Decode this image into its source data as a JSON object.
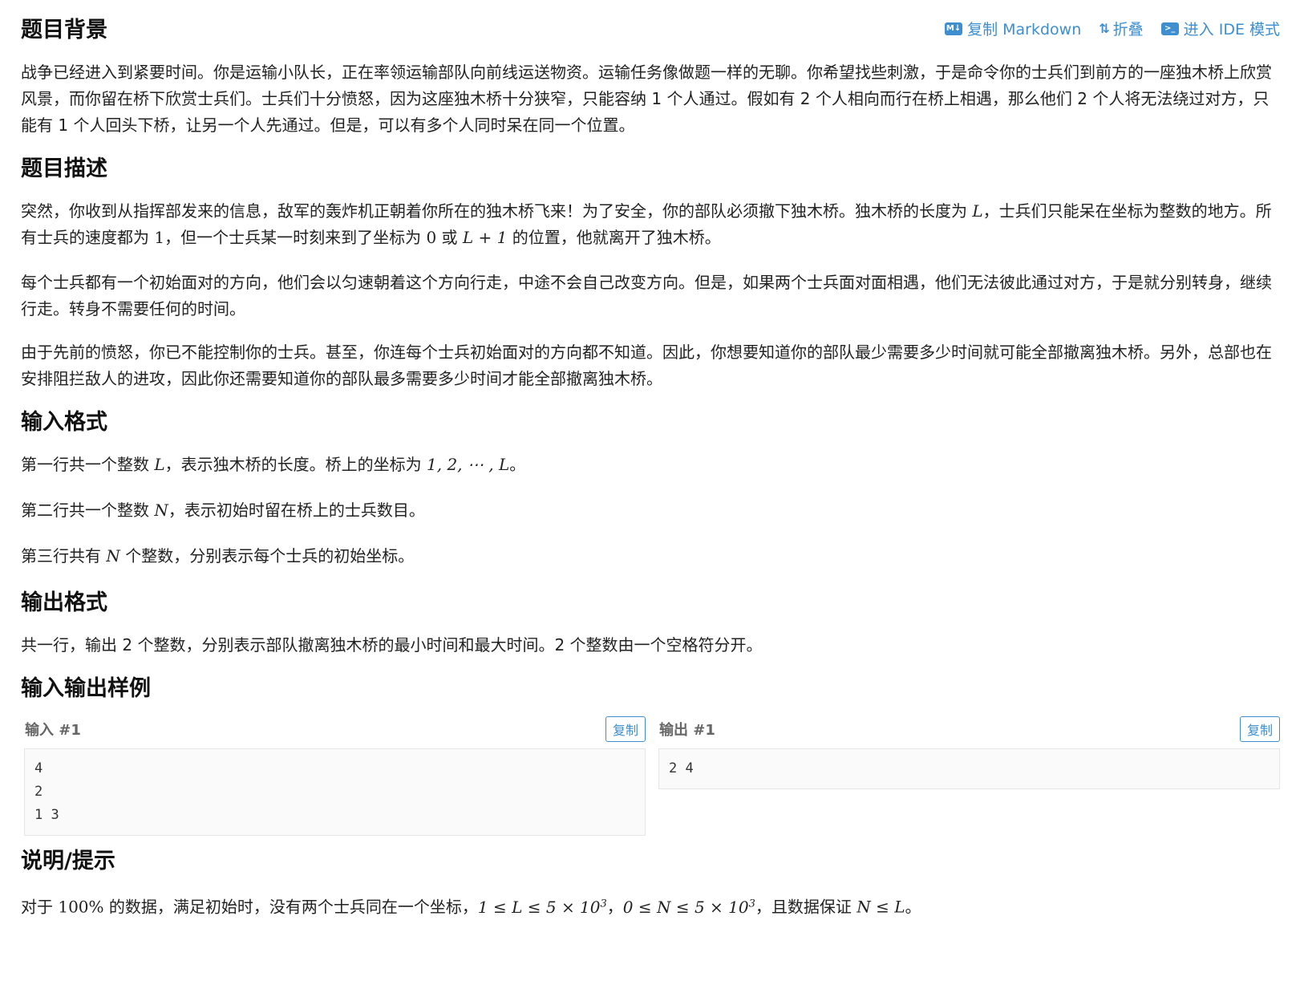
{
  "toolbar": {
    "copy_md_icon": "M↓",
    "copy_md_label": "复制 Markdown",
    "fold_label": "折叠",
    "ide_label": "进入 IDE 模式"
  },
  "sections": {
    "background": {
      "title": "题目背景",
      "p1": "战争已经进入到紧要时间。你是运输小队长，正在率领运输部队向前线运送物资。运输任务像做题一样的无聊。你希望找些刺激，于是命令你的士兵们到前方的一座独木桥上欣赏风景，而你留在桥下欣赏士兵们。士兵们十分愤怒，因为这座独木桥十分狭窄，只能容纳 1 个人通过。假如有 2 个人相向而行在桥上相遇，那么他们 2 个人将无法绕过对方，只能有 1 个人回头下桥，让另一个人先通过。但是，可以有多个人同时呆在同一个位置。"
    },
    "description": {
      "title": "题目描述",
      "p1a": "突然，你收到从指挥部发来的信息，敌军的轰炸机正朝着你所在的独木桥飞来！为了安全，你的部队必须撤下独木桥。独木桥的长度为 ",
      "p1b": "，士兵们只能呆在坐标为整数的地方。所有士兵的速度都为 ",
      "p1c": "，但一个士兵某一时刻来到了坐标为 ",
      "p1d": " 或 ",
      "p1e": " 的位置，他就离开了独木桥。",
      "p2": "每个士兵都有一个初始面对的方向，他们会以匀速朝着这个方向行走，中途不会自己改变方向。但是，如果两个士兵面对面相遇，他们无法彼此通过对方，于是就分别转身，继续行走。转身不需要任何的时间。",
      "p3": "由于先前的愤怒，你已不能控制你的士兵。甚至，你连每个士兵初始面对的方向都不知道。因此，你想要知道你的部队最少需要多少时间就可能全部撤离独木桥。另外，总部也在安排阻拦敌人的进攻，因此你还需要知道你的部队最多需要多少时间才能全部撤离独木桥。"
    },
    "input": {
      "title": "输入格式",
      "l1a": "第一行共一个整数 ",
      "l1b": "，表示独木桥的长度。桥上的坐标为 ",
      "l1c": "。",
      "l2a": "第二行共一个整数 ",
      "l2b": "，表示初始时留在桥上的士兵数目。",
      "l3a": "第三行共有 ",
      "l3b": " 个整数，分别表示每个士兵的初始坐标。"
    },
    "output": {
      "title": "输出格式",
      "p1": "共一行，输出 2 个整数，分别表示部队撤离独木桥的最小时间和最大时间。2 个整数由一个空格符分开。"
    },
    "samples": {
      "title": "输入输出样例",
      "input_title": "输入 #1",
      "output_title": "输出 #1",
      "copy_label": "复制",
      "input_text": "4\n2\n1 3",
      "output_text": "2 4"
    },
    "hint": {
      "title": "说明/提示",
      "pa": "对于 ",
      "pb": " 的数据，满足初始时，没有两个士兵同在一个坐标，",
      "pc": "，",
      "pd": "，且数据保证 ",
      "pe": "。"
    }
  },
  "math": {
    "L": "L",
    "N": "N",
    "one": "1",
    "zero": "0",
    "L_plus_1": "L + 1",
    "coords": "1, 2, ⋯ , L",
    "pct": "100%",
    "range_L": "1 ≤ L ≤ 5 × 10",
    "range_N": "0 ≤ N ≤ 5 × 10",
    "exp": "3",
    "n_le_l": "N ≤ L"
  },
  "colors": {
    "accent": "#3e8ed0",
    "heading": "#111111",
    "text": "#222222"
  }
}
